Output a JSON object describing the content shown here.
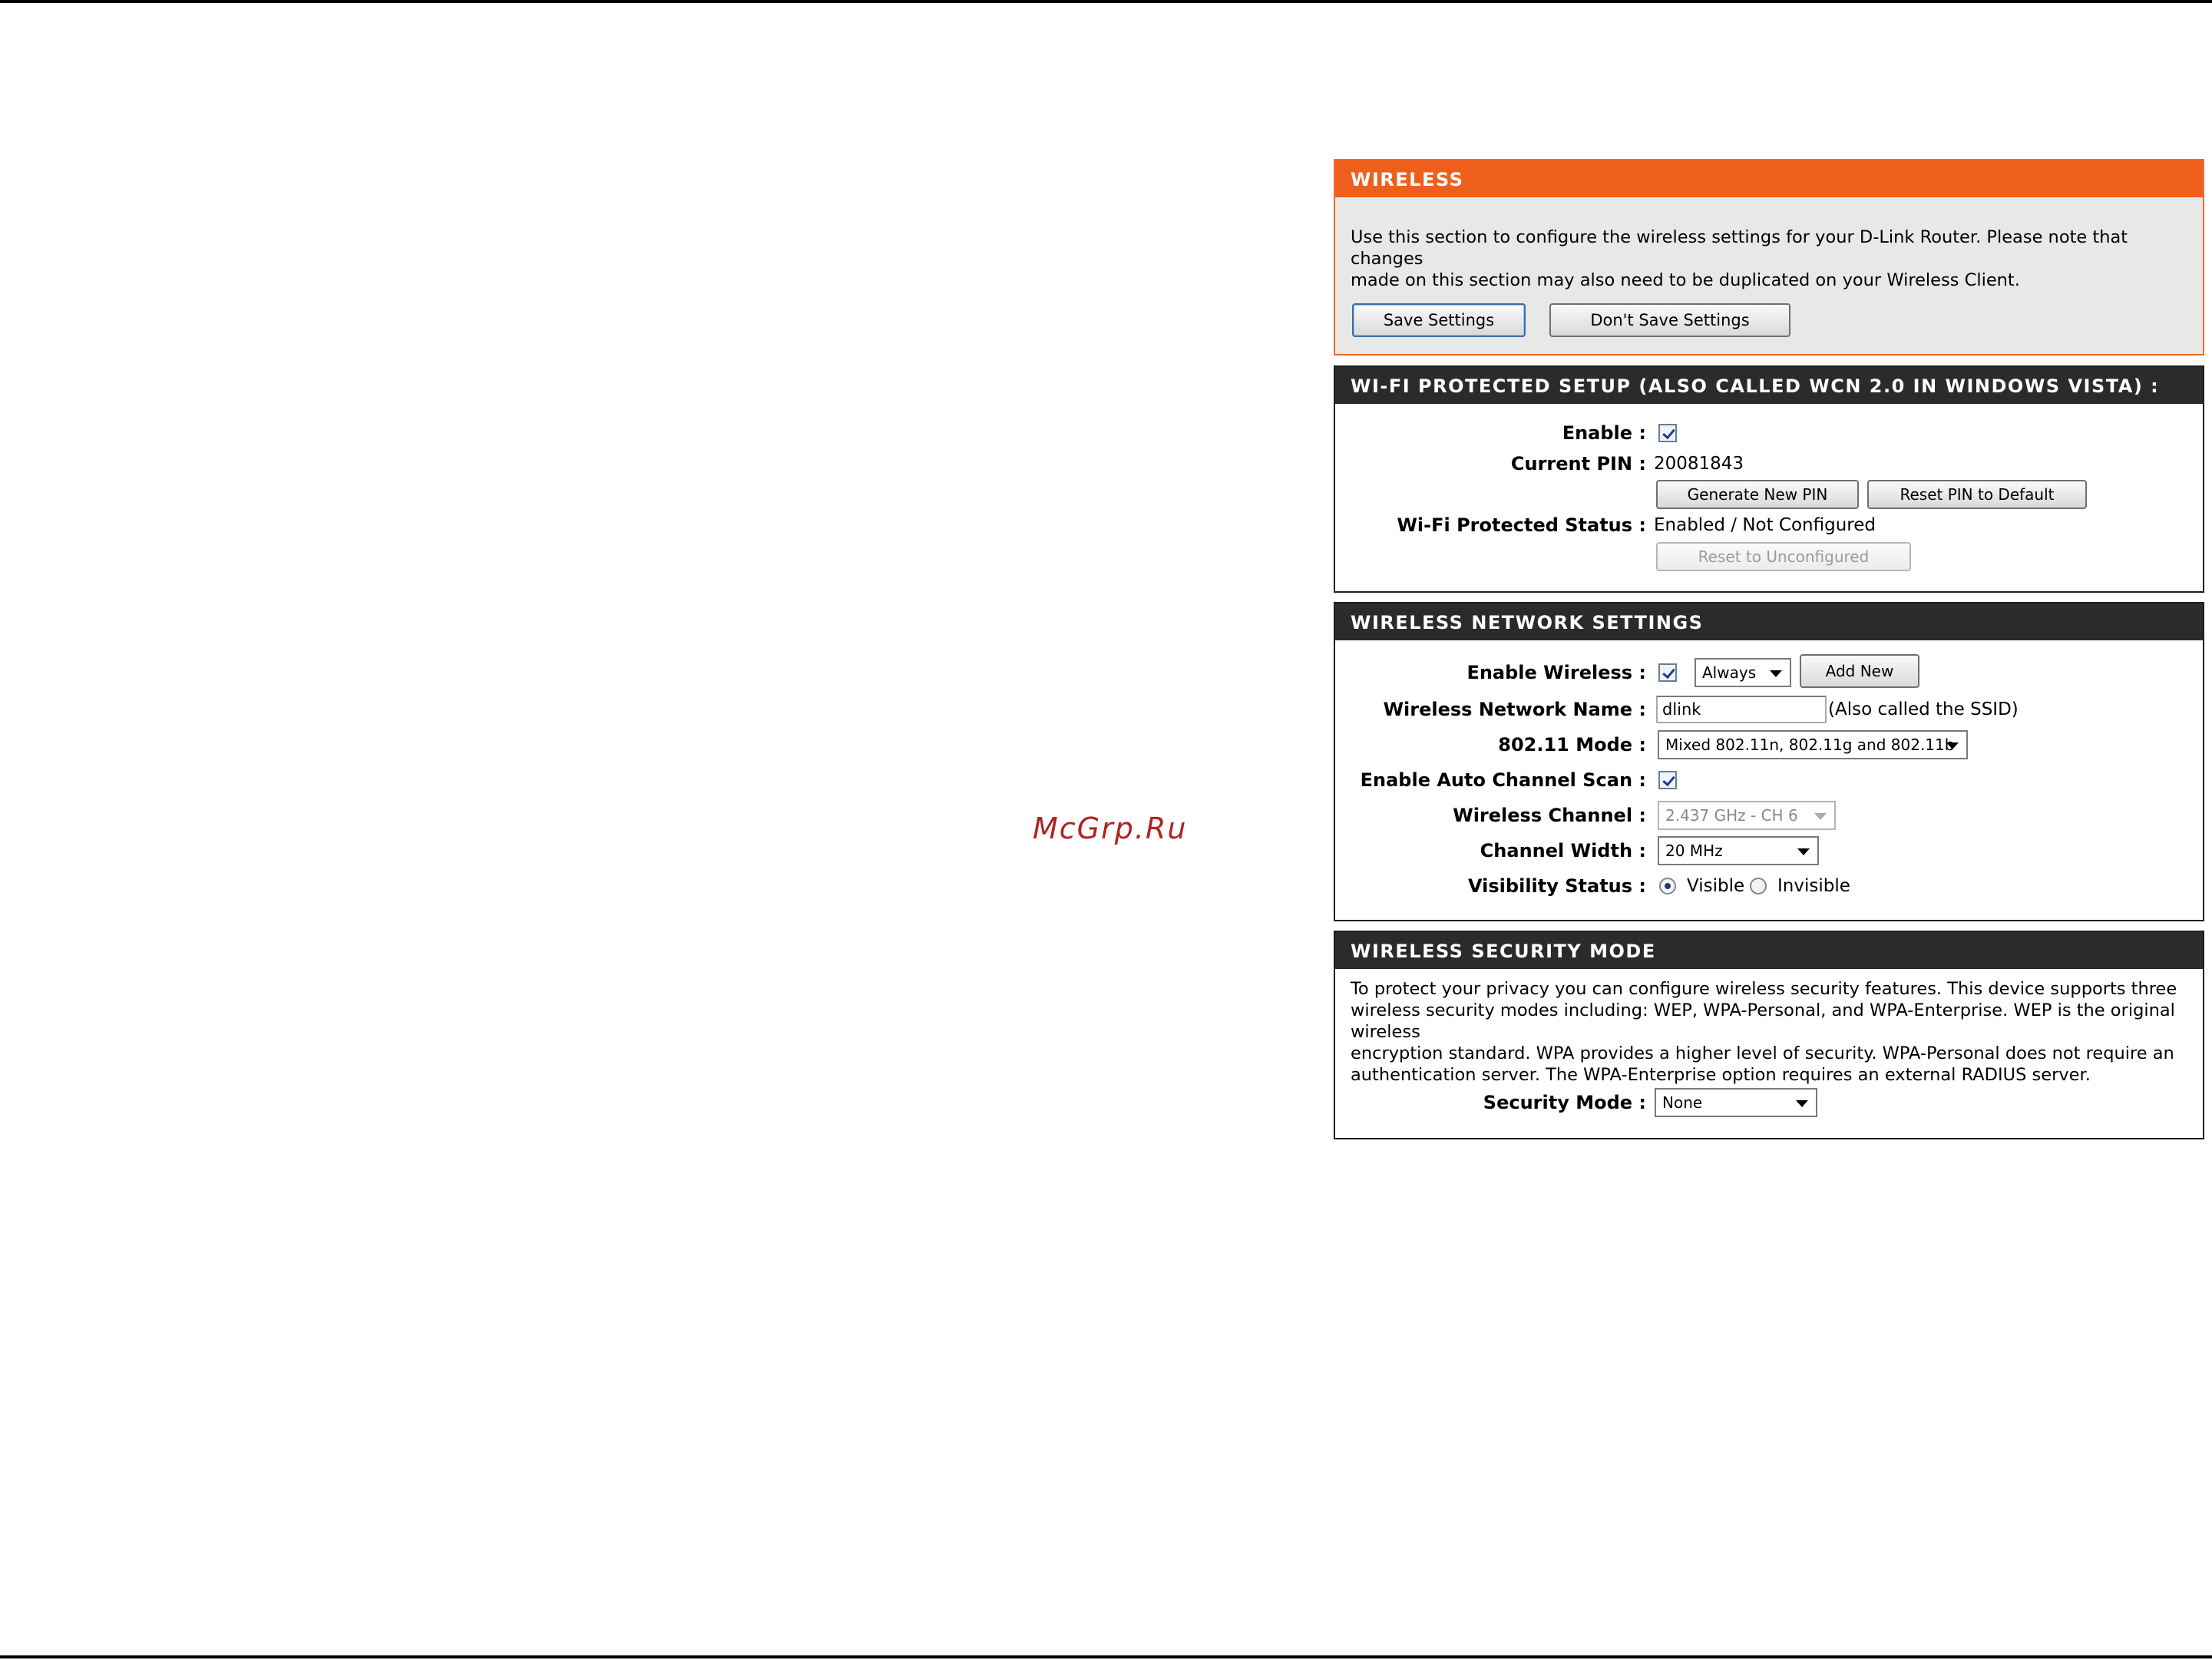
{
  "watermark": "McGrp.Ru",
  "wireless": {
    "title": "WIRELESS",
    "description_line1": "Use this section to configure the wireless settings for your D-Link Router. Please note that changes",
    "description_line2": "made on this section may also need to be duplicated on your Wireless Client.",
    "save_label": "Save Settings",
    "dont_save_label": "Don't Save Settings"
  },
  "wps": {
    "title": "WI-FI PROTECTED SETUP (ALSO CALLED WCN 2.0 IN WINDOWS VISTA) :",
    "enable_label": "Enable :",
    "enable_checked": true,
    "pin_label": "Current PIN :",
    "pin_value": "20081843",
    "generate_label": "Generate New PIN",
    "reset_pin_label": "Reset PIN to Default",
    "status_label": "Wi-Fi Protected Status :",
    "status_value": "Enabled / Not Configured",
    "reset_unconfigured_label": "Reset to Unconfigured"
  },
  "network": {
    "title": "WIRELESS NETWORK SETTINGS",
    "enable_wireless_label": "Enable Wireless :",
    "enable_wireless_checked": true,
    "schedule_value": "Always",
    "add_new_label": "Add New",
    "ssid_label": "Wireless Network Name :",
    "ssid_value": "dlink",
    "ssid_note": "(Also called the SSID)",
    "mode_label": "802.11 Mode :",
    "mode_value": "Mixed 802.11n, 802.11g and 802.11b",
    "auto_channel_label": "Enable Auto Channel Scan :",
    "auto_channel_checked": true,
    "channel_label": "Wireless Channel :",
    "channel_value": "2.437 GHz - CH 6",
    "width_label": "Channel Width :",
    "width_value": "20 MHz",
    "visibility_label": "Visibility Status :",
    "visible_label": "Visible",
    "invisible_label": "Invisible",
    "visibility_selected": "Visible"
  },
  "security": {
    "title": "WIRELESS SECURITY MODE",
    "description_line1": "To protect your privacy you can configure wireless security features. This device supports three",
    "description_line2": "wireless security modes including: WEP, WPA-Personal, and WPA-Enterprise. WEP is the original wireless",
    "description_line3": "encryption standard. WPA provides a higher level of security. WPA-Personal does not require an",
    "description_line4": "authentication server. The WPA-Enterprise option requires an external RADIUS server.",
    "mode_label": "Security Mode :",
    "mode_value": "None"
  }
}
